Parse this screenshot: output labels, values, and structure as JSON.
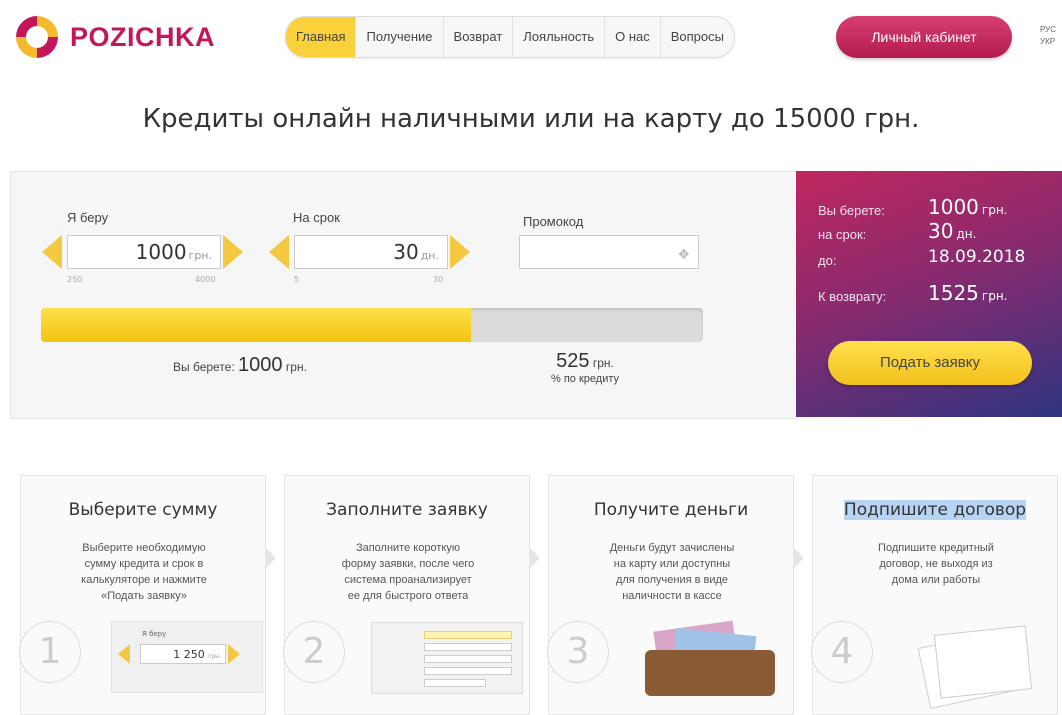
{
  "brand": {
    "name": "POZICHKA",
    "colors": [
      "#c2185b",
      "#fbd13b",
      "#2f3580"
    ]
  },
  "nav": {
    "items": [
      {
        "label": "Главная",
        "active": true
      },
      {
        "label": "Получение",
        "active": false
      },
      {
        "label": "Возврат",
        "active": false
      },
      {
        "label": "Лояльность",
        "active": false
      },
      {
        "label": "О нас",
        "active": false
      },
      {
        "label": "Вопросы",
        "active": false
      }
    ]
  },
  "header": {
    "cabinet_label": "Личный кабинет",
    "lang_top": "РУС",
    "lang_bottom": "УКР"
  },
  "headline": "Кредиты онлайн наличными или на карту до 15000 грн.",
  "calculator": {
    "amount": {
      "label": "Я беру",
      "value": "1000",
      "unit": "грн.",
      "min": "250",
      "max": "4000"
    },
    "term": {
      "label": "На срок",
      "value": "30",
      "unit": "дн.",
      "min": "5",
      "max": "30"
    },
    "promo": {
      "label": "Промокод",
      "placeholder": ""
    },
    "slider_fraction": 0.65,
    "summary_prefix": "Вы берете:",
    "summary_amount": "1000",
    "summary_unit": "грн.",
    "interest_value": "525",
    "interest_unit": "грн.",
    "interest_caption": "% по кредиту"
  },
  "result": {
    "take_label": "Вы берете:",
    "take_value": "1000",
    "take_unit": "грн.",
    "term_label": "на срок:",
    "term_value": "30",
    "term_unit": "дн.",
    "until_label": "до:",
    "until_value": "18.09.2018",
    "return_label": "К возврату:",
    "return_value": "1525",
    "return_unit": "грн.",
    "apply_label": "Подать заявку"
  },
  "steps": [
    {
      "number": "1",
      "title": "Выберите сумму",
      "description": "Выберите необходимую\nсумму кредита и срок в\nкалькуляторе и нажмите\n«Подать заявку»",
      "mini_label": "Я беру",
      "mini_value": "1 250",
      "mini_unit": "грн."
    },
    {
      "number": "2",
      "title": "Заполните заявку",
      "description": "Заполните короткую\nформу заявки, после чего\nсистема проанализирует\nее для быстрого ответа"
    },
    {
      "number": "3",
      "title": "Получите деньги",
      "description": "Деньги будут зачислены\nна карту или доступны\nдля получения в виде\nналичности в кассе"
    },
    {
      "number": "4",
      "title": "Подпишите договор",
      "description": "Подпишите кредитный\nдоговор, не выходя из\nдома или работы"
    }
  ]
}
